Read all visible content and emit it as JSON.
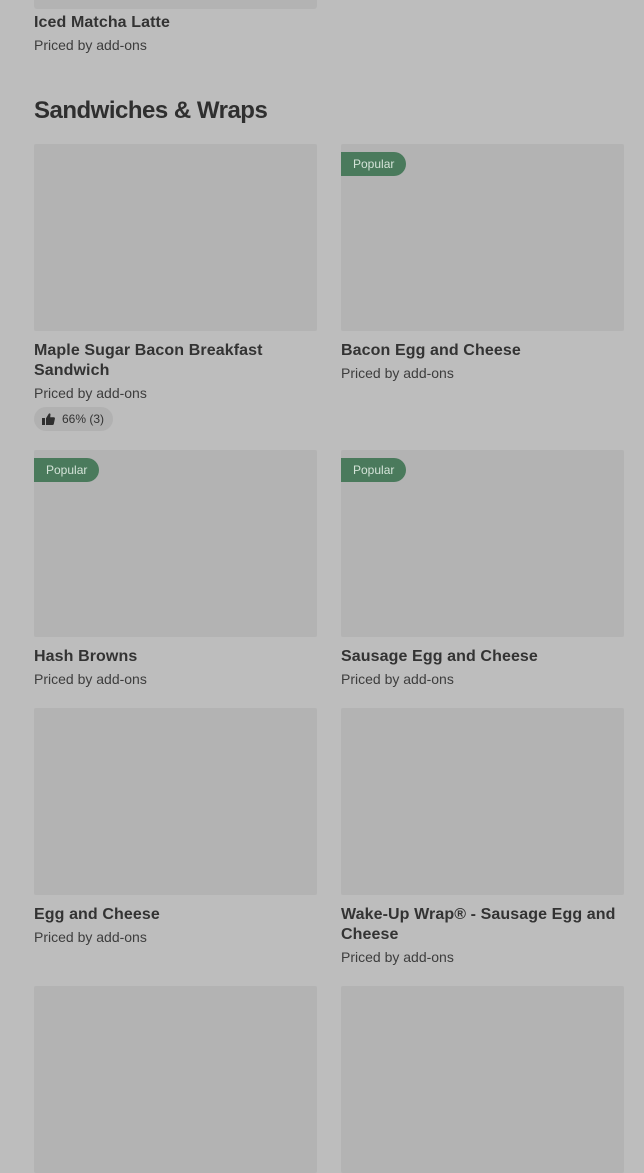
{
  "previous_item": {
    "name": "Iced Matcha Latte",
    "price": "Priced by add-ons"
  },
  "section": {
    "title": "Sandwiches & Wraps"
  },
  "items": [
    {
      "name": "Maple Sugar Bacon Breakfast Sandwich",
      "price": "Priced by add-ons",
      "badge": "",
      "rating": "66% (3)"
    },
    {
      "name": "Bacon Egg and Cheese",
      "price": "Priced by add-ons",
      "badge": "Popular",
      "rating": ""
    },
    {
      "name": "Hash Browns",
      "price": "Priced by add-ons",
      "badge": "Popular",
      "rating": ""
    },
    {
      "name": "Sausage Egg and Cheese",
      "price": "Priced by add-ons",
      "badge": "Popular",
      "rating": ""
    },
    {
      "name": "Egg and Cheese",
      "price": "Priced by add-ons",
      "badge": "",
      "rating": ""
    },
    {
      "name": "Wake-Up Wrap® - Sausage Egg and Cheese",
      "price": "Priced by add-ons",
      "badge": "",
      "rating": ""
    }
  ],
  "icons": {
    "rating": "thumbs-up-icon"
  },
  "colors": {
    "page_background": "#bdbdbd",
    "image_placeholder": "#b3b3b3",
    "badge_background": "#4a7a5c",
    "badge_text": "#d4e3d8"
  }
}
